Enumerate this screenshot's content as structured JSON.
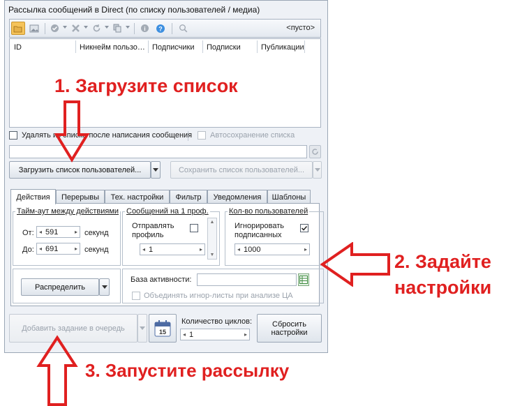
{
  "window": {
    "title": "Рассылка сообщений в Direct (по списку пользователей / медиа)"
  },
  "toolbar": {
    "icons": [
      "folder-open-icon",
      "image-icon",
      "check-circle-icon",
      "cross-icon",
      "refresh-icon",
      "copy-icon",
      "info-icon",
      "help-icon",
      "search-icon"
    ],
    "empty_label": "<пусто>"
  },
  "grid": {
    "columns": [
      "ID",
      "Никнейм пользо…",
      "Подписчики",
      "Подписки",
      "Публикации"
    ]
  },
  "options": {
    "delete_from_list": "Удалять из списка после написания сообщения",
    "autosave_list": "Автосохранение списка"
  },
  "path_field": {
    "value": ""
  },
  "buttons": {
    "load_users": "Загрузить список пользователей...",
    "save_users": "Сохранить список пользователей...",
    "distribute": "Распределить",
    "add_task": "Добавить задание в очередь",
    "reset_settings_line1": "Сбросить",
    "reset_settings_line2": "настройки"
  },
  "tabs": [
    {
      "label": "Действия",
      "active": true
    },
    {
      "label": "Перерывы",
      "active": false
    },
    {
      "label": "Тех. настройки",
      "active": false
    },
    {
      "label": "Фильтр",
      "active": false
    },
    {
      "label": "Уведомления",
      "active": false
    },
    {
      "label": "Шаблоны",
      "active": false
    }
  ],
  "timeout": {
    "title": "Тайм-аут между действиями",
    "from_label": "От:",
    "from_value": "591",
    "to_label": "До:",
    "to_value": "691",
    "unit": "секунд"
  },
  "messages_per_profile": {
    "title": "Сообщений на 1 проф.",
    "send_profile_line1": "Отправлять",
    "send_profile_line2": "профиль",
    "send_profile_checked": false,
    "count": "1"
  },
  "users_count": {
    "title": "Кол-во пользователей",
    "ignore_line1": "Игнорировать",
    "ignore_line2": "подписанных",
    "ignore_checked": true,
    "count": "1000"
  },
  "activity": {
    "base_label": "База активности:",
    "base_value": "",
    "merge_ignore": "Объединять игнор-листы при анализе ЦА"
  },
  "cycles": {
    "label": "Количество циклов:",
    "value": "1",
    "calendar_day": "15"
  },
  "annotations": {
    "step1": "1. Загрузите список",
    "step2_line1": "2. Задайте",
    "step2_line2": "настройки",
    "step3": "3. Запустите рассылку"
  },
  "colors": {
    "annotation": "#e02020",
    "panel_bg": "#eef1f6"
  }
}
